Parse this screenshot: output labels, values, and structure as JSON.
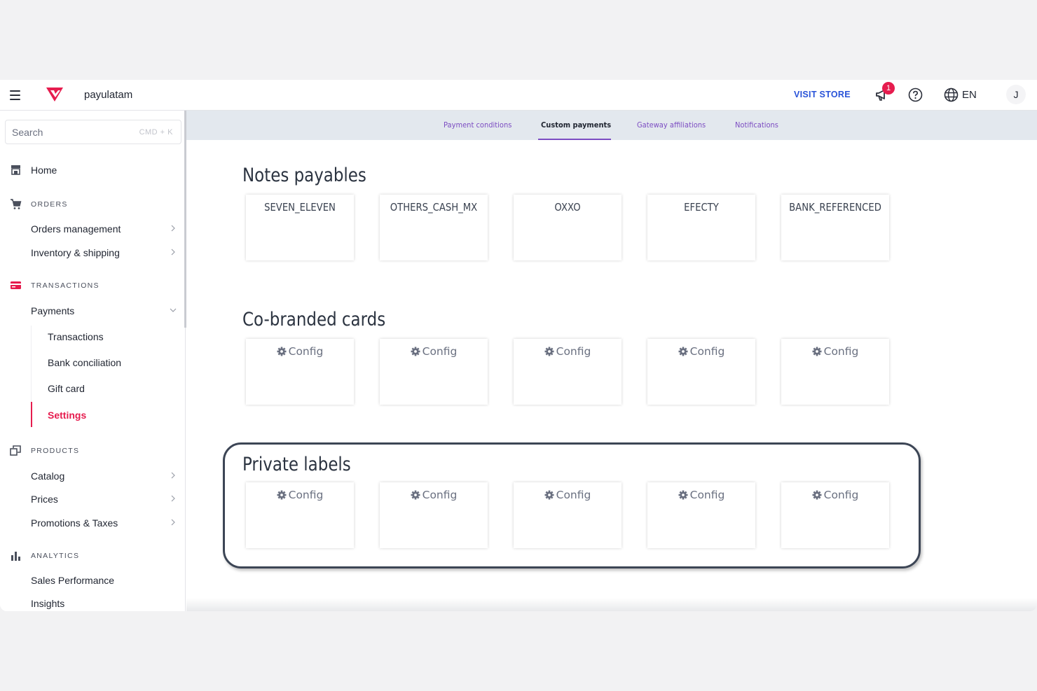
{
  "header": {
    "account_name": "payulatam",
    "visit_store_label": "VISIT STORE",
    "notification_count": "1",
    "language": "EN",
    "avatar_initial": "J",
    "brand_color": "#e61c4e",
    "link_color": "#2953d8"
  },
  "sidebar": {
    "search_placeholder": "Search",
    "search_shortcut": "CMD + K",
    "home_label": "Home",
    "sections": {
      "orders": {
        "label": "ORDERS",
        "items": [
          "Orders management",
          "Inventory & shipping"
        ]
      },
      "transactions": {
        "label": "TRANSACTIONS",
        "payments_label": "Payments",
        "sub_items": [
          "Transactions",
          "Bank conciliation",
          "Gift card",
          "Settings"
        ],
        "active_sub_item": "Settings"
      },
      "products": {
        "label": "PRODUCTS",
        "items": [
          "Catalog",
          "Prices",
          "Promotions & Taxes"
        ]
      },
      "analytics": {
        "label": "ANALYTICS",
        "items": [
          "Sales Performance",
          "Insights"
        ]
      }
    }
  },
  "tabs": {
    "items": [
      "Payment conditions",
      "Custom payments",
      "Gateway affiliations",
      "Notifications"
    ],
    "active": "Custom payments",
    "accent_color": "#7c4cc2"
  },
  "main": {
    "notes_payables": {
      "title": "Notes payables",
      "cards": [
        "SEVEN_ELEVEN",
        "OTHERS_CASH_MX",
        "OXXO",
        "EFECTY",
        "BANK_REFERENCED"
      ]
    },
    "co_branded": {
      "title": "Co-branded cards",
      "cards": [
        "Config",
        "Config",
        "Config",
        "Config",
        "Config"
      ]
    },
    "private_labels": {
      "title": "Private labels",
      "cards": [
        "Config",
        "Config",
        "Config",
        "Config",
        "Config"
      ],
      "highlighted": true
    }
  }
}
